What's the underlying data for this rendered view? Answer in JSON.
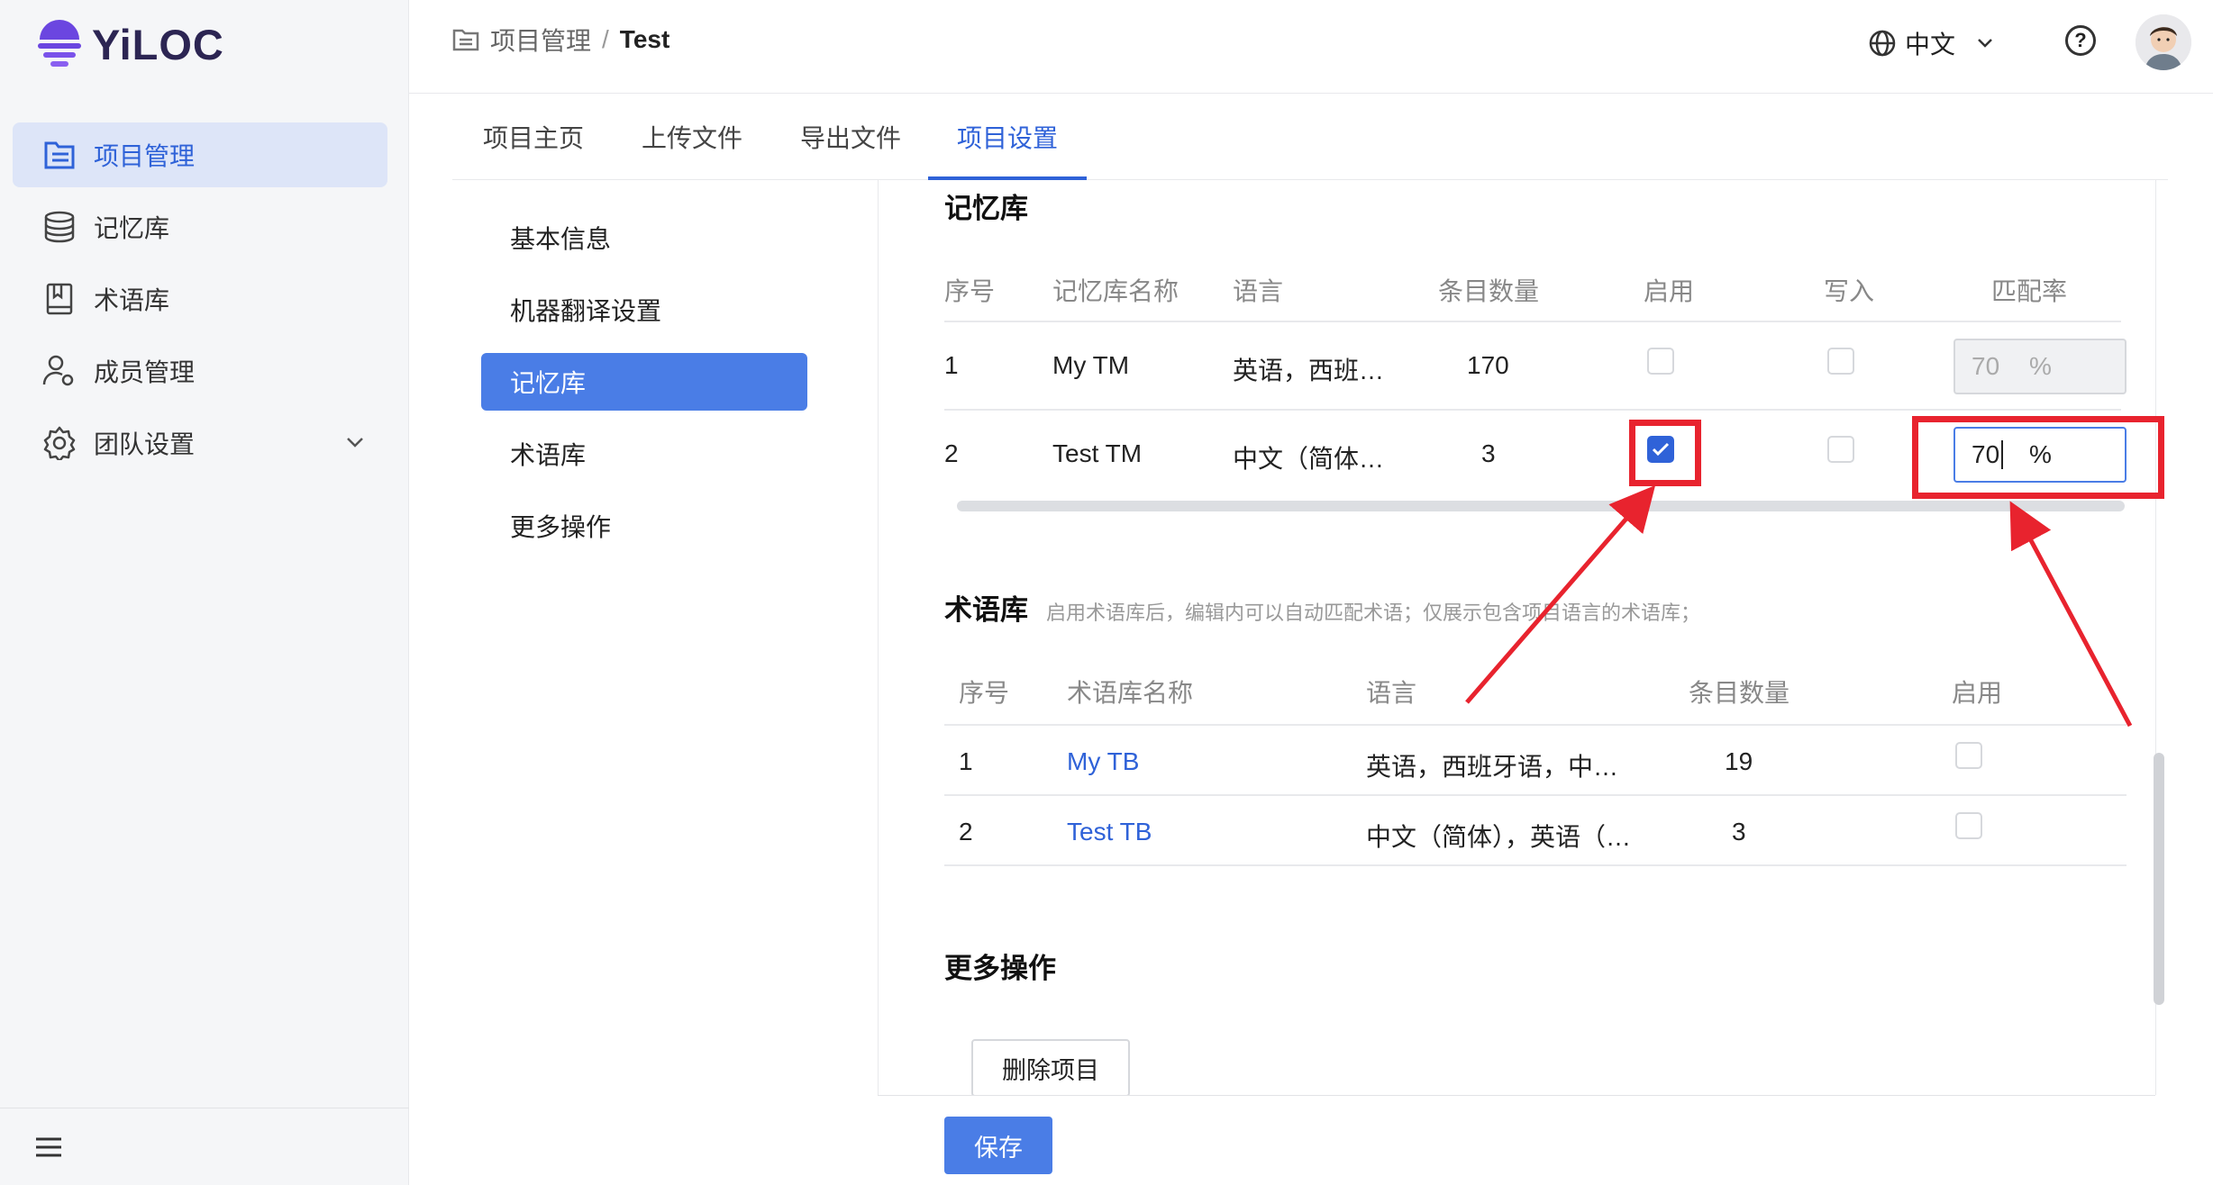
{
  "app": {
    "logo_text": "YiLOC"
  },
  "sidebar": {
    "items": [
      {
        "label": "项目管理",
        "icon": "project-list-icon",
        "active": true
      },
      {
        "label": "记忆库",
        "icon": "database-icon",
        "active": false
      },
      {
        "label": "术语库",
        "icon": "book-icon",
        "active": false
      },
      {
        "label": "成员管理",
        "icon": "user-gear-icon",
        "active": false
      },
      {
        "label": "团队设置",
        "icon": "gear-icon",
        "active": false
      }
    ]
  },
  "header": {
    "breadcrumb": {
      "root": "项目管理",
      "separator": "/",
      "current": "Test"
    },
    "language": "中文"
  },
  "tabs": [
    {
      "label": "项目主页"
    },
    {
      "label": "上传文件"
    },
    {
      "label": "导出文件"
    },
    {
      "label": "项目设置",
      "active": true
    }
  ],
  "settings_menu": [
    {
      "label": "基本信息"
    },
    {
      "label": "机器翻译设置"
    },
    {
      "label": "记忆库",
      "active": true
    },
    {
      "label": "术语库"
    },
    {
      "label": "更多操作"
    }
  ],
  "tm_section": {
    "title": "记忆库",
    "headers": [
      "序号",
      "记忆库名称",
      "语言",
      "条目数量",
      "启用",
      "写入",
      "匹配率"
    ],
    "rows": [
      {
        "no": "1",
        "name": "My TM",
        "lang": "英语，西班…",
        "count": "170",
        "enabled": false,
        "write": false,
        "rate": "70",
        "unit": "%"
      },
      {
        "no": "2",
        "name": "Test TM",
        "lang": "中文（简体…",
        "count": "3",
        "enabled": true,
        "write": false,
        "rate": "70",
        "unit": "%"
      }
    ]
  },
  "tb_section": {
    "title": "术语库",
    "note": "启用术语库后，编辑内可以自动匹配术语；仅展示包含项目语言的术语库；",
    "headers": [
      "序号",
      "术语库名称",
      "语言",
      "条目数量",
      "启用"
    ],
    "rows": [
      {
        "no": "1",
        "name": "My TB",
        "lang": "英语，西班牙语，中…",
        "count": "19",
        "enabled": false
      },
      {
        "no": "2",
        "name": "Test TB",
        "lang": "中文（简体），英语（…",
        "count": "3",
        "enabled": false
      }
    ]
  },
  "more_section": {
    "title": "更多操作",
    "delete_label": "删除项目"
  },
  "footer": {
    "save_label": "保存"
  },
  "colors": {
    "accent": "#2f62d8",
    "highlight": "#e8232e",
    "brand": "#5b3fd6"
  }
}
